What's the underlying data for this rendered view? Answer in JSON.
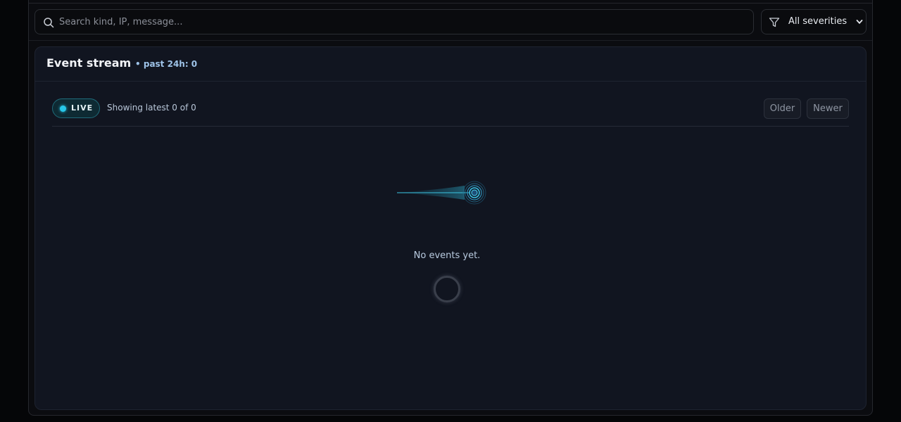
{
  "search": {
    "placeholder": "Search kind, IP, message..."
  },
  "filters": {
    "severity_selected": "All severities",
    "severity_icon": "filter-icon"
  },
  "panel": {
    "title": "Event stream",
    "subtitle": "• past 24h: 0"
  },
  "stream": {
    "live_label": "LIVE",
    "showing_text": "Showing latest 0 of 0",
    "older_label": "Older",
    "newer_label": "Newer",
    "empty_text": "No events yet."
  },
  "colors": {
    "accent": "#27c7e8",
    "panel_bg": "#111520",
    "page_bg": "#0b0c10"
  }
}
